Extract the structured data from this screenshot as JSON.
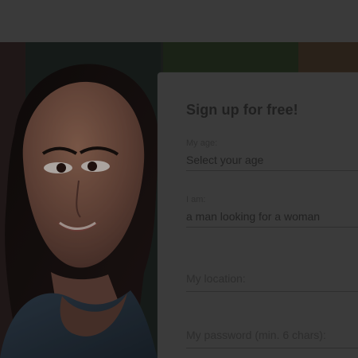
{
  "signup": {
    "title": "Sign up for free!",
    "age": {
      "label": "My age:",
      "value": "Select your age"
    },
    "i_am": {
      "label": "I am:",
      "value": "a man looking for a woman"
    },
    "location": {
      "label": "My location:"
    },
    "password": {
      "label": "My password (min. 6 chars):"
    }
  },
  "colors": {
    "page_background": "#303030",
    "card_background": "#3b3b3b",
    "text_dark": "#1f1f1f",
    "label_text": "#2c2c2c"
  },
  "icons": {
    "hero": "woman-photo"
  }
}
